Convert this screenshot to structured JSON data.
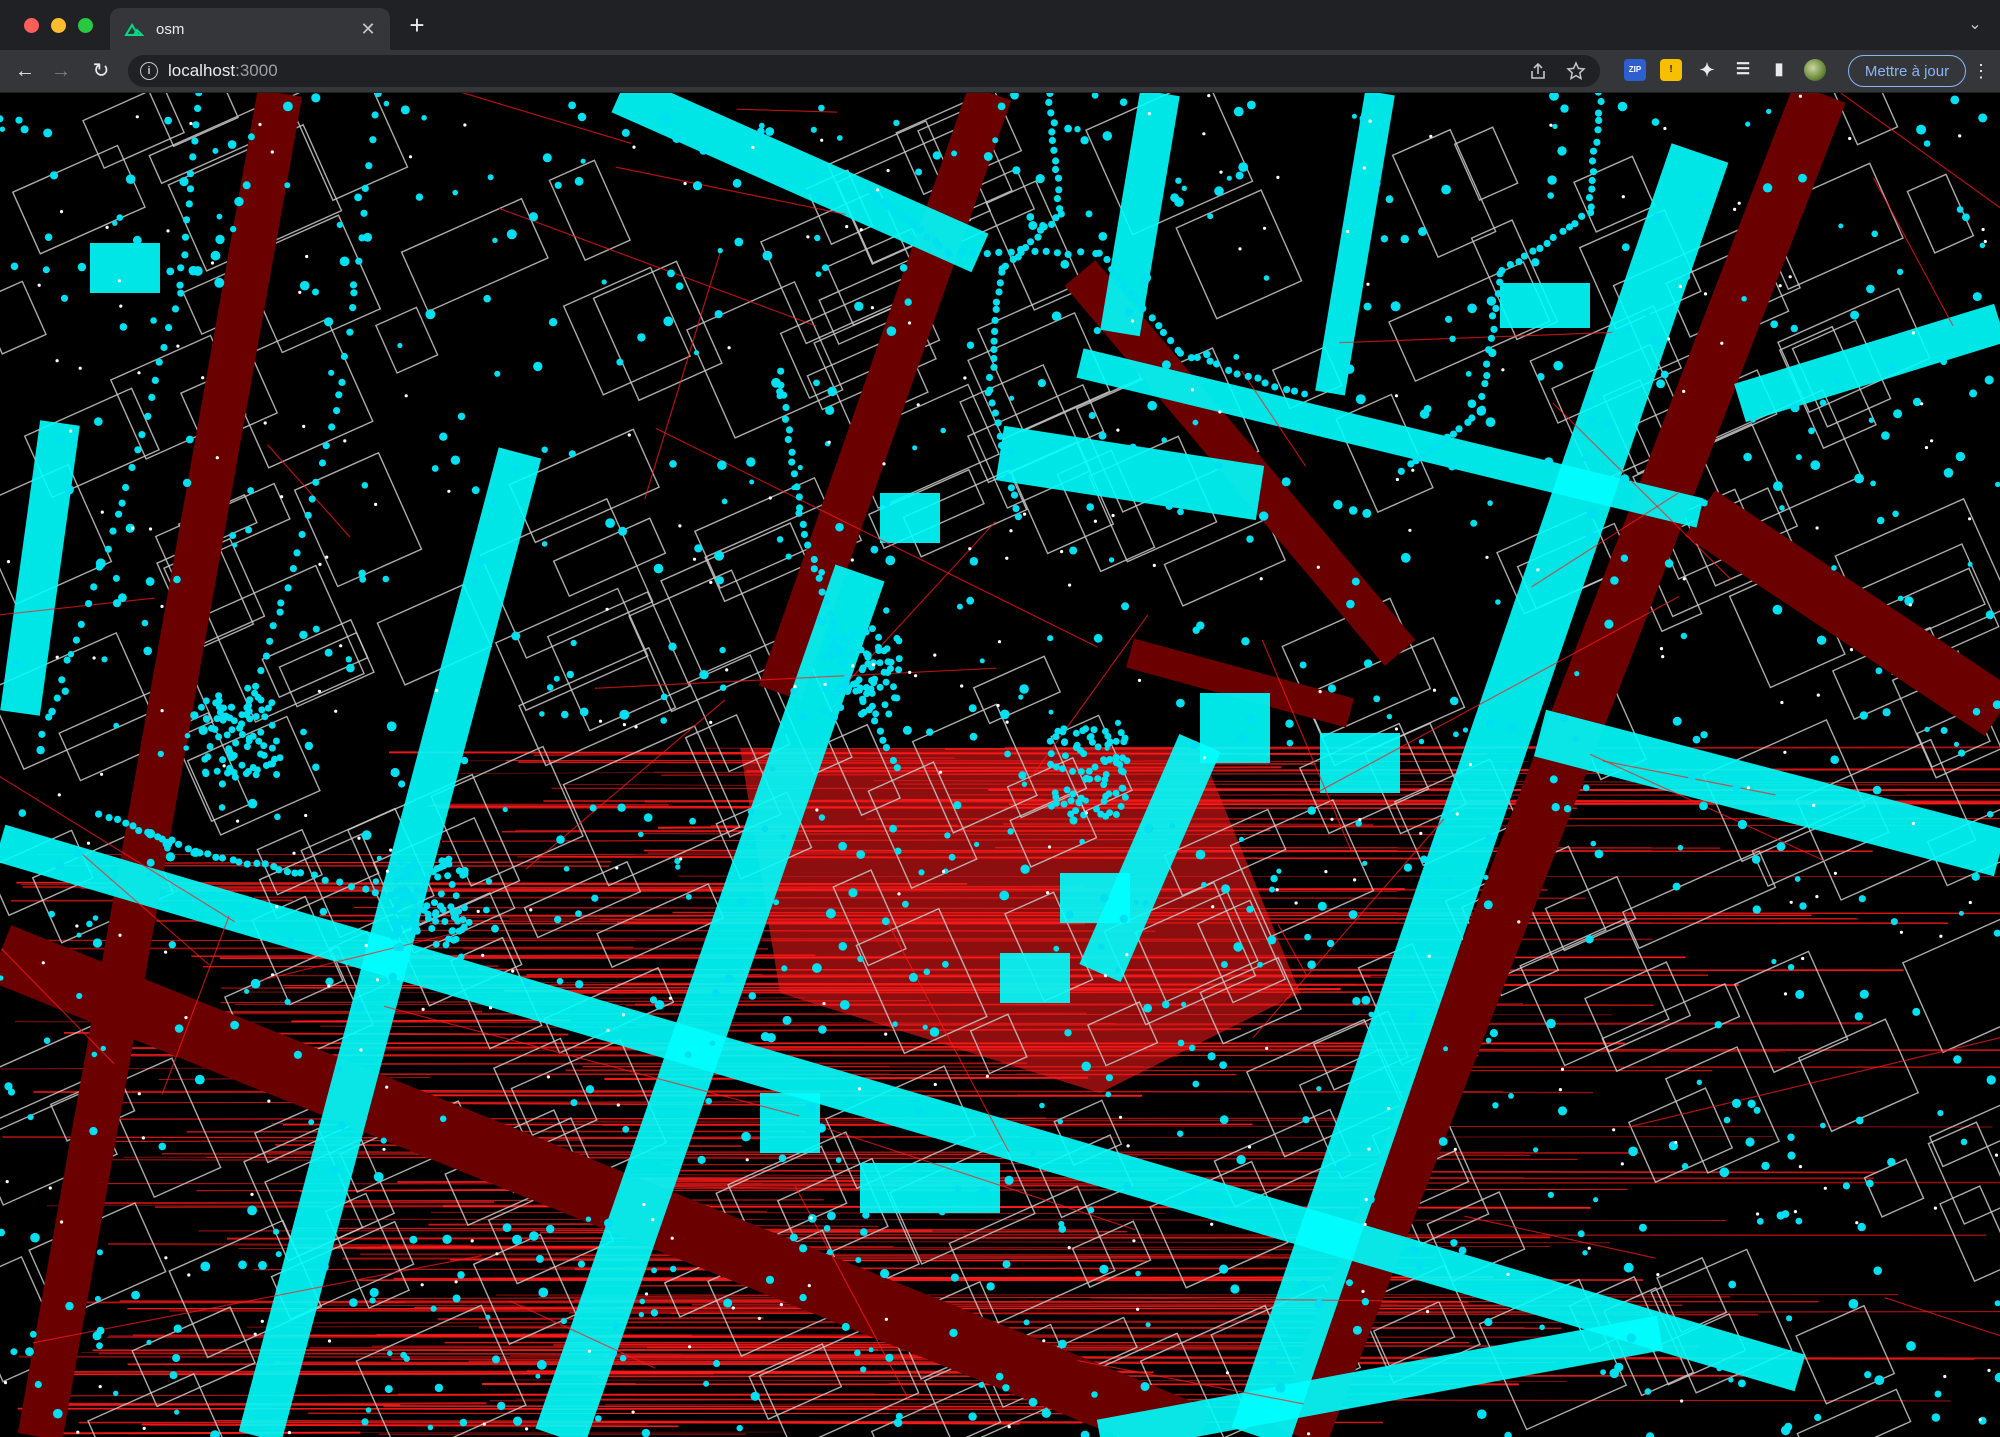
{
  "browser": {
    "tab": {
      "title": "osm",
      "favicon": "nuxt-logo-icon",
      "close_glyph": "✕"
    },
    "new_tab_glyph": "+",
    "tab_search_glyph": "⌄",
    "nav": {
      "back": "←",
      "forward": "→",
      "reload": "↻"
    },
    "url": {
      "host": "localhost",
      "port": ":3000"
    },
    "omnibox_icons": [
      "share-icon",
      "bookmark-star-icon"
    ],
    "extensions": [
      {
        "name": "zip-extension-icon",
        "label": "ZIP"
      },
      {
        "name": "yellow-extension-icon",
        "label": "!"
      },
      {
        "name": "puzzle-extensions-icon",
        "label": ""
      },
      {
        "name": "reading-list-icon",
        "label": ""
      },
      {
        "name": "side-panel-icon",
        "label": ""
      },
      {
        "name": "profile-avatar-icon",
        "label": ""
      }
    ],
    "update_button": "Mettre à jour",
    "menu_glyph": "⋮"
  },
  "map": {
    "background": "#000000",
    "layers": {
      "roads_dark": "#6b0000",
      "roads_light": "#00ffff",
      "buildings_stroke": "#c8c8c8",
      "nodes": "#00e0f0",
      "hatch": "#ff1a1a",
      "small_nodes": "#ffffff"
    }
  }
}
